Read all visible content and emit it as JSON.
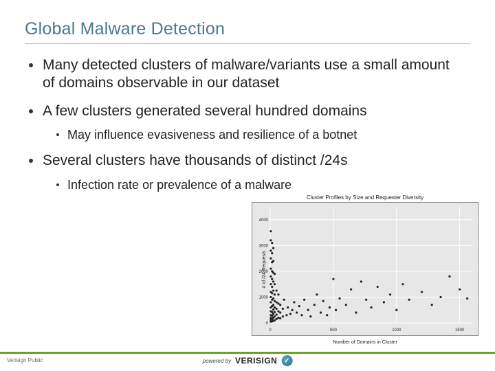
{
  "title": "Global Malware Detection",
  "bullets": [
    {
      "level": 1,
      "text": "Many detected clusters of malware/variants use a small amount of domains observable in our dataset"
    },
    {
      "level": 1,
      "text": "A few clusters generated several hundred domains"
    },
    {
      "level": 2,
      "text": "May influence evasiveness and resilience of a botnet"
    },
    {
      "level": 1,
      "text": "Several clusters have thousands of distinct /24s"
    },
    {
      "level": 2,
      "text": "Infection rate or prevalence of a malware"
    }
  ],
  "footer": {
    "classification": "Verisign Public",
    "powered": "powered by",
    "brand": "VERISIGN",
    "mark": "✓"
  },
  "chart_data": {
    "type": "scatter",
    "title": "Cluster Profiles by Size and Requester Diversity",
    "xlabel": "Number of Domains in Cluster",
    "ylabel": "# of /24 Requests",
    "xlim": [
      0,
      1600
    ],
    "ylim": [
      0,
      4500
    ],
    "xticks": [
      0,
      500,
      1000,
      1500
    ],
    "yticks": [
      0,
      1000,
      2000,
      3000,
      4000
    ],
    "points": [
      [
        5,
        50
      ],
      [
        5,
        120
      ],
      [
        5,
        200
      ],
      [
        5,
        300
      ],
      [
        5,
        450
      ],
      [
        5,
        600
      ],
      [
        5,
        800
      ],
      [
        5,
        1000
      ],
      [
        5,
        1200
      ],
      [
        5,
        1500
      ],
      [
        5,
        1800
      ],
      [
        5,
        2100
      ],
      [
        5,
        2500
      ],
      [
        5,
        2800
      ],
      [
        5,
        3200
      ],
      [
        5,
        3550
      ],
      [
        15,
        60
      ],
      [
        15,
        150
      ],
      [
        15,
        280
      ],
      [
        15,
        420
      ],
      [
        15,
        650
      ],
      [
        15,
        900
      ],
      [
        15,
        1150
      ],
      [
        15,
        1400
      ],
      [
        15,
        1700
      ],
      [
        15,
        2000
      ],
      [
        15,
        2350
      ],
      [
        15,
        2700
      ],
      [
        15,
        3100
      ],
      [
        25,
        80
      ],
      [
        25,
        200
      ],
      [
        25,
        350
      ],
      [
        25,
        520
      ],
      [
        25,
        700
      ],
      [
        25,
        950
      ],
      [
        25,
        1250
      ],
      [
        25,
        1600
      ],
      [
        25,
        1950
      ],
      [
        25,
        2400
      ],
      [
        25,
        2900
      ],
      [
        35,
        100
      ],
      [
        35,
        250
      ],
      [
        35,
        420
      ],
      [
        35,
        600
      ],
      [
        35,
        850
      ],
      [
        35,
        1100
      ],
      [
        35,
        1500
      ],
      [
        35,
        1900
      ],
      [
        50,
        150
      ],
      [
        50,
        320
      ],
      [
        50,
        550
      ],
      [
        50,
        800
      ],
      [
        50,
        1250
      ],
      [
        65,
        200
      ],
      [
        65,
        450
      ],
      [
        65,
        750
      ],
      [
        65,
        1100
      ],
      [
        80,
        180
      ],
      [
        80,
        400
      ],
      [
        80,
        700
      ],
      [
        100,
        250
      ],
      [
        100,
        550
      ],
      [
        110,
        900
      ],
      [
        130,
        300
      ],
      [
        140,
        600
      ],
      [
        160,
        350
      ],
      [
        175,
        500
      ],
      [
        190,
        800
      ],
      [
        210,
        400
      ],
      [
        230,
        650
      ],
      [
        250,
        300
      ],
      [
        270,
        900
      ],
      [
        300,
        500
      ],
      [
        320,
        250
      ],
      [
        350,
        700
      ],
      [
        370,
        1100
      ],
      [
        400,
        400
      ],
      [
        420,
        850
      ],
      [
        450,
        300
      ],
      [
        470,
        600
      ],
      [
        500,
        1700
      ],
      [
        520,
        500
      ],
      [
        550,
        950
      ],
      [
        600,
        700
      ],
      [
        640,
        1300
      ],
      [
        680,
        400
      ],
      [
        720,
        1600
      ],
      [
        760,
        900
      ],
      [
        800,
        600
      ],
      [
        850,
        1400
      ],
      [
        900,
        800
      ],
      [
        950,
        1100
      ],
      [
        1000,
        500
      ],
      [
        1050,
        1500
      ],
      [
        1100,
        900
      ],
      [
        1200,
        1200
      ],
      [
        1280,
        700
      ],
      [
        1350,
        1000
      ],
      [
        1420,
        1800
      ],
      [
        1500,
        1300
      ],
      [
        1560,
        950
      ]
    ]
  }
}
